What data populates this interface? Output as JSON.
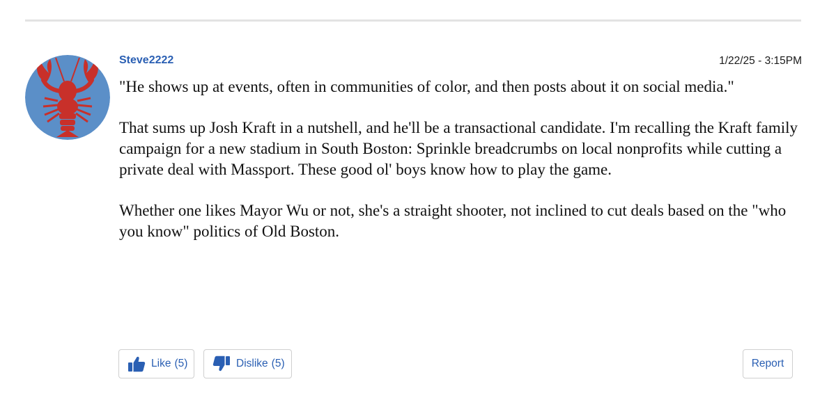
{
  "comment": {
    "username": "Steve2222",
    "timestamp": "1/22/25 - 3:15PM",
    "paragraphs": [
      "\"He shows up at events, often in communities of color, and then posts about it on social media.\"",
      "That sums up Josh Kraft in a nutshell, and he'll be a transactional candidate. I'm recalling the Kraft family campaign for a new stadium in South Boston: Sprinkle breadcrumbs on local nonprofits while cutting a private deal with Massport. These good ol' boys know how to play the game.",
      "Whether one likes Mayor Wu or not, she's a straight shooter, not inclined to cut deals based on the \"who you know\" politics of Old Boston."
    ],
    "avatar_icon": "lobster-icon"
  },
  "actions": {
    "like_label": "Like",
    "like_count": "(5)",
    "dislike_label": "Dislike",
    "dislike_count": "(5)",
    "report_label": "Report",
    "like_icon": "thumbs-up-icon",
    "dislike_icon": "thumbs-down-icon"
  },
  "colors": {
    "accent": "#2a5fb3",
    "avatar_background": "#5b8fc8",
    "avatar_figure": "#c8302a",
    "divider": "#e3e3e3"
  }
}
